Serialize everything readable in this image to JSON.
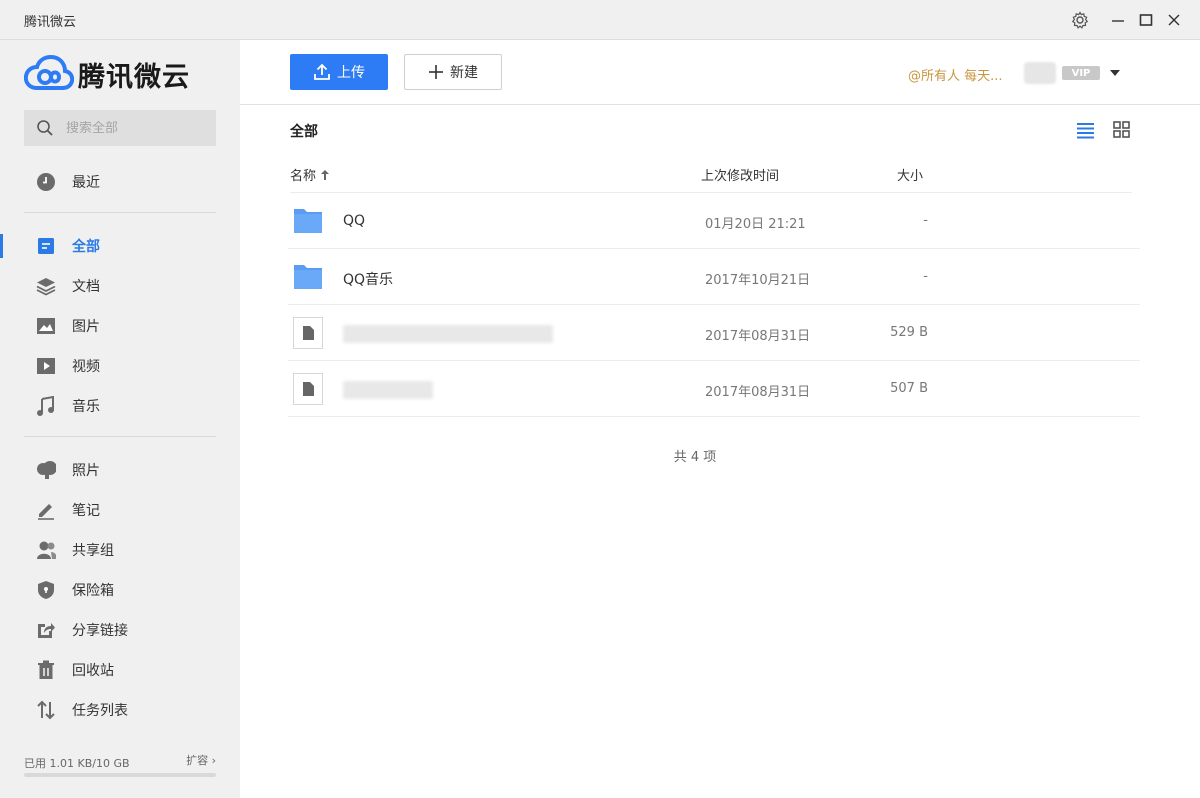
{
  "window": {
    "title": "腾讯微云"
  },
  "brand": {
    "name": "腾讯微云",
    "accent": "#2d7cf6"
  },
  "search": {
    "placeholder": "搜索全部"
  },
  "sidebar": {
    "items": [
      {
        "label": "最近",
        "icon": "clock-icon"
      },
      {
        "label": "全部",
        "icon": "all-files-icon",
        "active": true
      },
      {
        "label": "文档",
        "icon": "layers-icon"
      },
      {
        "label": "图片",
        "icon": "image-icon"
      },
      {
        "label": "视频",
        "icon": "video-icon"
      },
      {
        "label": "音乐",
        "icon": "music-icon"
      },
      {
        "label": "照片",
        "icon": "photo-icon"
      },
      {
        "label": "笔记",
        "icon": "pen-icon"
      },
      {
        "label": "共享组",
        "icon": "group-icon"
      },
      {
        "label": "保险箱",
        "icon": "shield-icon"
      },
      {
        "label": "分享链接",
        "icon": "share-icon"
      },
      {
        "label": "回收站",
        "icon": "trash-icon"
      },
      {
        "label": "任务列表",
        "icon": "transfer-icon"
      }
    ],
    "storage": {
      "used_text": "已用 1.01 KB/10 GB",
      "expand_label": "扩容",
      "used_fraction": 0.0001
    }
  },
  "toolbar": {
    "upload_label": "上传",
    "new_label": "新建",
    "notice": "@所有人 每天...",
    "vip_label": "VIP"
  },
  "main": {
    "breadcrumb": "全部",
    "columns": {
      "name": "名称",
      "modified": "上次修改时间",
      "size": "大小"
    },
    "files": [
      {
        "type": "folder",
        "name": "QQ",
        "modified": "01月20日 21:21",
        "size": "-"
      },
      {
        "type": "folder",
        "name": "QQ音乐",
        "modified": "2017年10月21日",
        "size": "-"
      },
      {
        "type": "file",
        "name": "",
        "modified": "2017年08月31日",
        "size": "529 B"
      },
      {
        "type": "file",
        "name": "",
        "modified": "2017年08月31日",
        "size": "507 B"
      }
    ],
    "total": "共 4 项"
  }
}
